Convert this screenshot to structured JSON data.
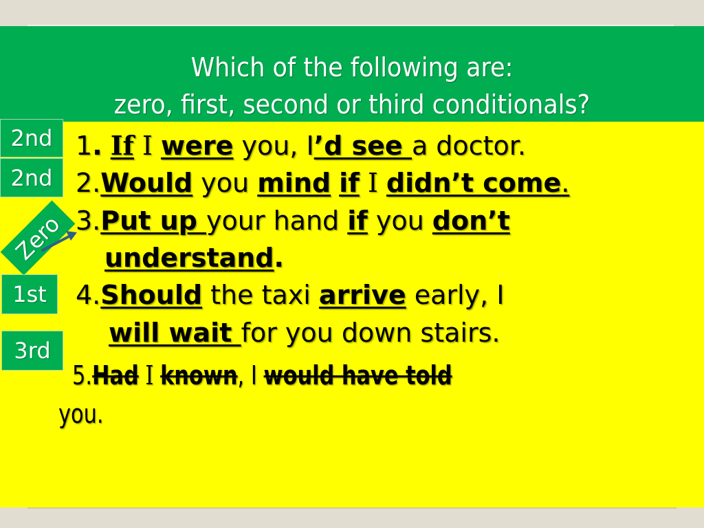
{
  "slide": {
    "title_line1": "Which of the following are:",
    "title_line2": "zero, first, second or third conditionals?",
    "badges": [
      {
        "label": "2nd",
        "for_item": 1
      },
      {
        "label": "2nd",
        "for_item": 2
      },
      {
        "label": "Zero",
        "for_item": 3
      },
      {
        "label": "1st",
        "for_item": 4
      },
      {
        "label": "3rd",
        "for_item": 5
      }
    ],
    "items": {
      "s1": {
        "num": "1",
        "dot": ".",
        "if": "If",
        "i1": " I ",
        "were": "were",
        "you": " you, I",
        "dsee": "’d see ",
        "rest": "a doctor."
      },
      "s2": {
        "num": "2.",
        "would": "Would",
        "you": " you ",
        "mind": "mind",
        "sp": " ",
        "if": "if",
        "i": " I ",
        "didnt": "didn’t come",
        "dot": "."
      },
      "s3": {
        "num": "3.",
        "putup": "Put up ",
        "yourhand": "your hand ",
        "if": "if",
        "you": " you ",
        "dont": "don’t",
        "understand": "understand",
        "dot": "."
      },
      "s4": {
        "num": "4.",
        "should": "Should",
        "thetaxi": " the taxi ",
        "arrive": "arrive",
        "early": " early, I",
        "willwait": "will wait ",
        "rest": "for you down stairs."
      },
      "s5": {
        "num": "5.",
        "had": "Had",
        "i1": " I ",
        "known": "known",
        "comma": ", I ",
        "would": "would have told",
        "you": "you."
      }
    }
  }
}
